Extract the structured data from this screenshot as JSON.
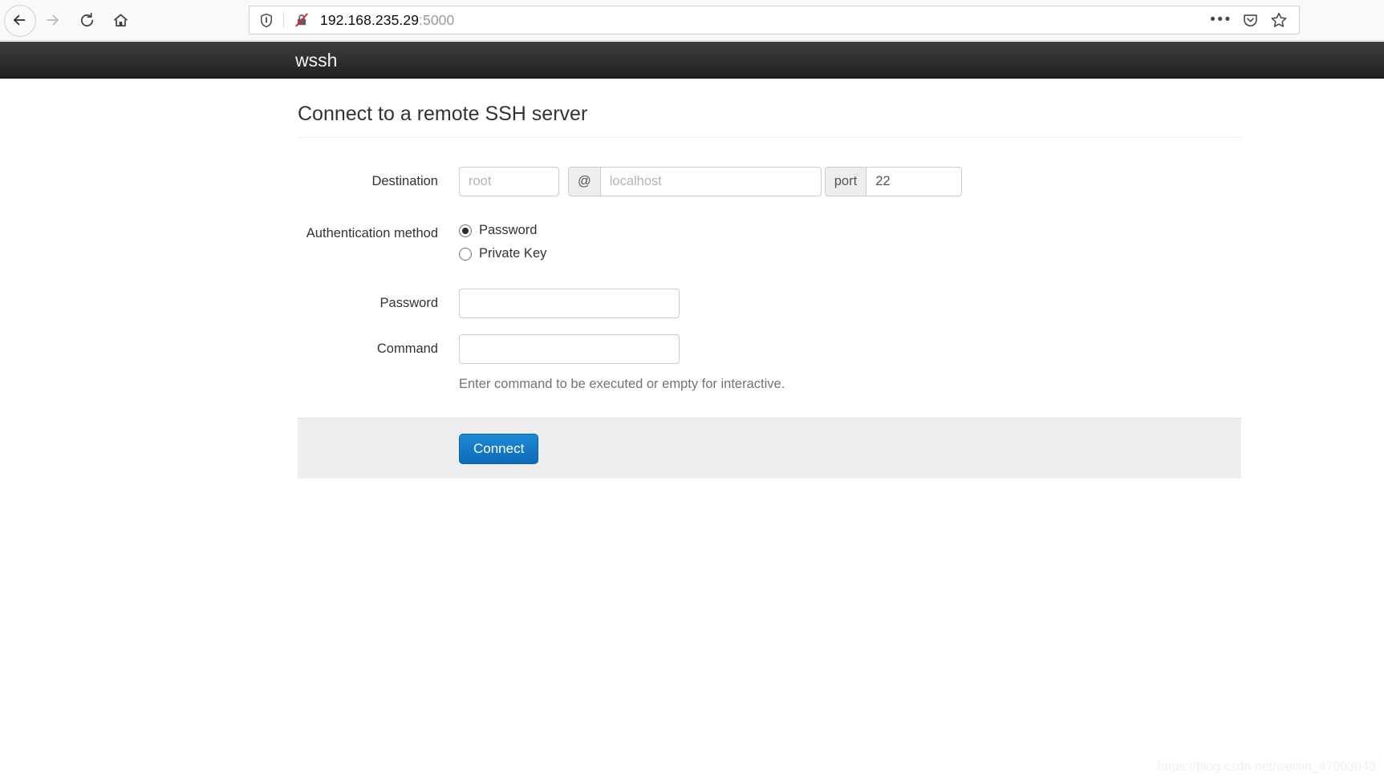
{
  "browser": {
    "nav": {
      "back_icon": "arrow-left-icon",
      "forward_icon": "arrow-right-icon",
      "reload_icon": "reload-icon",
      "home_icon": "home-icon"
    },
    "urlbar": {
      "shield_icon": "shield-icon",
      "insecure_icon": "lock-crossed-out-icon",
      "url_host": "192.168.235.29",
      "url_port": ":5000",
      "page_actions_icon": "ellipsis-icon",
      "pocket_icon": "pocket-icon",
      "bookmark_icon": "star-icon"
    }
  },
  "app": {
    "brand": "wssh",
    "page_title": "Connect to a remote SSH server",
    "form": {
      "destination": {
        "label": "Destination",
        "username_value": "",
        "username_placeholder": "root",
        "at_addon": "@",
        "hostname_value": "",
        "hostname_placeholder": "localhost",
        "port_addon": "port",
        "port_value": "22",
        "port_placeholder": ""
      },
      "auth_method": {
        "label": "Authentication method",
        "options": [
          {
            "label": "Password",
            "checked": true
          },
          {
            "label": "Private Key",
            "checked": false
          }
        ]
      },
      "password": {
        "label": "Password",
        "value": "",
        "placeholder": ""
      },
      "command": {
        "label": "Command",
        "value": "",
        "placeholder": "",
        "help": "Enter command to be executed or empty for interactive."
      },
      "submit_label": "Connect"
    }
  },
  "watermark": "https://blog.csdn.net/weixin_47003048",
  "colors": {
    "navbar_bg": "#222222",
    "primary_button": "#0d6ab8",
    "footer_bg": "#eeeeee",
    "text": "#333333",
    "muted_text": "#737373"
  }
}
